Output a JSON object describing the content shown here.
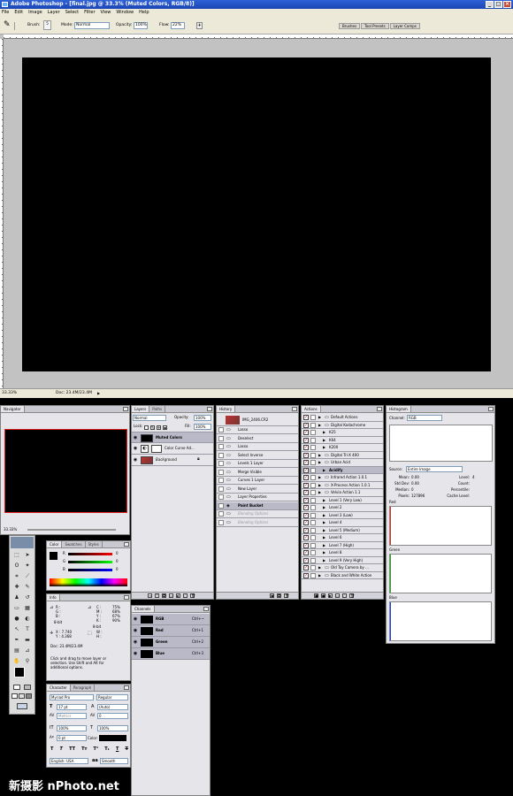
{
  "window": {
    "title": "Adobe Photoshop - [final.jpg @ 33.3% (Muted Colors, RGB/8)]"
  },
  "menu": [
    "File",
    "Edit",
    "Image",
    "Layer",
    "Select",
    "Filter",
    "View",
    "Window",
    "Help"
  ],
  "options": {
    "brush_label": "Brush:",
    "brush_size": "5",
    "mode_label": "Mode:",
    "mode_value": "Normal",
    "opacity_label": "Opacity:",
    "opacity_value": "100%",
    "flow_label": "Flow:",
    "flow_value": "22%",
    "palette_well_tabs": [
      "Brushes",
      "Tool Presets",
      "Layer Comps"
    ]
  },
  "status": {
    "zoom": "33.33%",
    "doc": "Doc: 23.4M/23.4M"
  },
  "navigator": {
    "tabs": [
      "Navigator"
    ],
    "zoom": "33.33%"
  },
  "color": {
    "tabs": [
      "Color",
      "Swatches",
      "Styles"
    ],
    "r_value": "0",
    "g_value": "0",
    "b_value": "0"
  },
  "info": {
    "tabs": [
      "Info"
    ],
    "rgb_labels": [
      "R :",
      "G :",
      "B :"
    ],
    "cmyk_labels": [
      "C :",
      "M :",
      "Y :",
      "K :"
    ],
    "cmyk_values": [
      "75%",
      "68%",
      "67%",
      "90%"
    ],
    "bitdepth": "8-bit",
    "x_label": "X :",
    "x_value": "7.740",
    "y_label": "Y :",
    "y_value": "4.368",
    "w_label": "W :",
    "h_label": "H :",
    "doc": "Doc: 23.4M/23.4M",
    "hint": "Click and drag to move layer or selection. Use Shift and Alt for additional options."
  },
  "character": {
    "tabs": [
      "Character",
      "Paragraph"
    ],
    "font": "Myriad Pro",
    "style": "Regular",
    "size": "17 pt",
    "leading": "(Auto)",
    "kerning": "Metrics",
    "tracking": "0",
    "vscale": "100%",
    "hscale": "100%",
    "baseline": "0 pt",
    "color_label": "Color:",
    "language": "English: USA",
    "aa_label": "aa",
    "antialias": "Smooth"
  },
  "layers": {
    "tabs": [
      "Layers",
      "Paths"
    ],
    "blend": "Normal",
    "opacity_label": "Opacity:",
    "opacity": "100%",
    "lock_label": "Lock:",
    "fill_label": "Fill:",
    "fill": "100%",
    "items": [
      {
        "name": "Muted Colors"
      },
      {
        "name": "Color Curve Ad..."
      },
      {
        "name": "Background"
      }
    ]
  },
  "channels": {
    "tabs": [
      "Channels"
    ],
    "items": [
      {
        "name": "RGB",
        "shortcut": "Ctrl+~"
      },
      {
        "name": "Red",
        "shortcut": "Ctrl+1"
      },
      {
        "name": "Green",
        "shortcut": "Ctrl+2"
      },
      {
        "name": "Blue",
        "shortcut": "Ctrl+3"
      }
    ]
  },
  "history": {
    "tabs": [
      "History"
    ],
    "snapshot": "IMG_2406.CR2",
    "items": [
      "Lasso",
      "Deselect",
      "Lasso",
      "Select Inverse",
      "Levels 1 Layer",
      "Merge Visible",
      "Curves 1 Layer",
      "New Layer",
      "Layer Properties",
      "Paint Bucket",
      "Blending Options",
      "Blending Options"
    ]
  },
  "actions": {
    "tabs": [
      "Actions"
    ],
    "items": [
      {
        "name": "Default Actions",
        "level": 0
      },
      {
        "name": "Digital Kodachrome",
        "level": 0
      },
      {
        "name": "K25",
        "level": 1
      },
      {
        "name": "K64",
        "level": 1
      },
      {
        "name": "K200",
        "level": 1
      },
      {
        "name": "Digital Tri-X 400",
        "level": 0
      },
      {
        "name": "Urban Acid",
        "level": 0
      },
      {
        "name": "Acidify",
        "level": 1
      },
      {
        "name": "Infrared Action 1.0.1",
        "level": 0
      },
      {
        "name": "X-Process Action 1.0.1",
        "level": 0
      },
      {
        "name": "Velvia Action 1.1",
        "level": 0
      },
      {
        "name": "Level 1 (Very Low)",
        "level": 1
      },
      {
        "name": "Level 2",
        "level": 1
      },
      {
        "name": "Level 3 (Low)",
        "level": 1
      },
      {
        "name": "Level 4",
        "level": 1
      },
      {
        "name": "Level 5 (Medium)",
        "level": 1
      },
      {
        "name": "Level 6",
        "level": 1
      },
      {
        "name": "Level 7 (High)",
        "level": 1
      },
      {
        "name": "Level 8",
        "level": 1
      },
      {
        "name": "Level 9 (Very High)",
        "level": 1
      },
      {
        "name": "Old Toy Camera by ...",
        "level": 0
      },
      {
        "name": "Black and White Action",
        "level": 0
      }
    ]
  },
  "histogram": {
    "tabs": [
      "Histogram"
    ],
    "channel_label": "Channel:",
    "channel": "RGB",
    "source_label": "Source:",
    "source": "Entire Image",
    "stats_left": [
      {
        "label": "Mean:",
        "value": "0.00"
      },
      {
        "label": "Std Dev:",
        "value": "0.00"
      },
      {
        "label": "Median:",
        "value": "0"
      },
      {
        "label": "Pixels:",
        "value": "127896"
      }
    ],
    "stats_right": [
      {
        "label": "Level:",
        "value": ""
      },
      {
        "label": "Count:",
        "value": ""
      },
      {
        "label": "Percentile:",
        "value": ""
      },
      {
        "label": "Cache Level:",
        "value": "4"
      }
    ],
    "sections": [
      {
        "label": "Red",
        "color": "#e03030"
      },
      {
        "label": "Green",
        "color": "#20b020"
      },
      {
        "label": "Blue",
        "color": "#2040e0"
      }
    ]
  },
  "watermark": "新摄影 nPhoto.net"
}
